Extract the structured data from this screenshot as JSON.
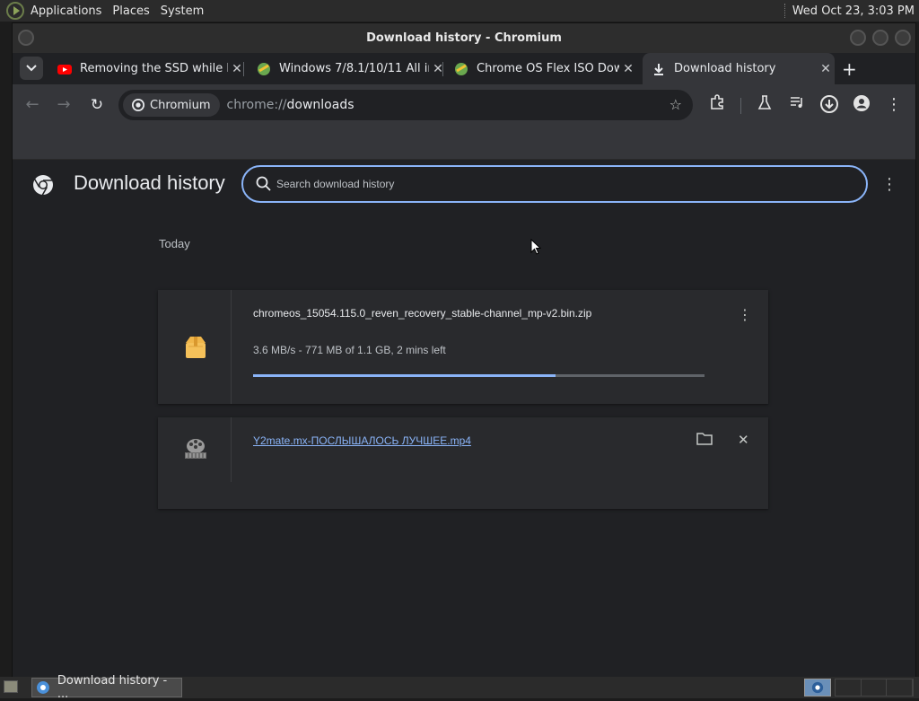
{
  "top_panel": {
    "menus": [
      "Applications",
      "Places",
      "System"
    ],
    "clock": "Wed Oct 23,  3:03 PM"
  },
  "window": {
    "title": "Download history - Chromium"
  },
  "tabs": [
    {
      "title": "Removing the SSD while l",
      "favicon": "youtube-icon",
      "active": false
    },
    {
      "title": "Windows 7/8.1/10/11 All in",
      "favicon": "site-icon",
      "active": false
    },
    {
      "title": "Chrome OS Flex ISO Dow",
      "favicon": "site-icon",
      "active": false
    },
    {
      "title": "Download history",
      "favicon": "download-icon",
      "active": true
    }
  ],
  "omnibox": {
    "chip_label": "Chromium",
    "url_scheme": "chrome://",
    "url_host": "downloads"
  },
  "downloads_page": {
    "title": "Download history",
    "search_placeholder": "Search download history",
    "section_label": "Today",
    "items": [
      {
        "filename": "chromeos_15054.115.0_reven_recovery_stable-channel_mp-v2.bin.zip",
        "status": "3.6 MB/s - 771 MB of 1.1 GB, 2 mins left",
        "progress_fraction": 0.67,
        "icon": "archive-icon",
        "in_progress": true
      },
      {
        "filename": "Y2mate.mx-ПОСЛЫШАЛОСЬ ЛУЧШЕЕ.mp4",
        "icon": "video-file-icon",
        "in_progress": false
      }
    ]
  },
  "taskbar": {
    "task_label": "Download history - ..."
  },
  "colors": {
    "accent": "#8ab4f8",
    "page_bg": "#202124",
    "card_bg": "#292a2d",
    "toolbar_bg": "#35363a"
  }
}
